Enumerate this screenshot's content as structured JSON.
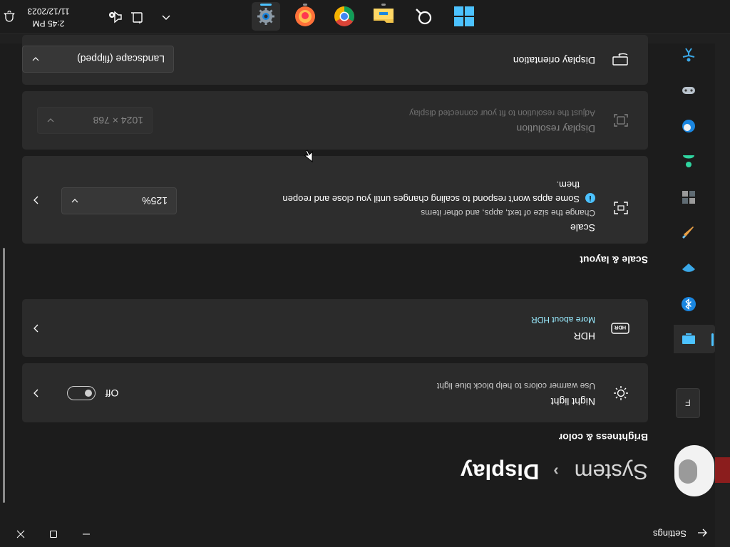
{
  "window": {
    "app_title": "Settings",
    "controls": {
      "minimize": "minimize-icon",
      "maximize": "maximize-icon",
      "close": "close-icon"
    }
  },
  "nav": {
    "search_label": "F",
    "items": [
      {
        "icon": "system-icon",
        "active": true
      },
      {
        "icon": "bluetooth-icon"
      },
      {
        "icon": "network-icon"
      },
      {
        "icon": "personalization-icon"
      },
      {
        "icon": "apps-icon"
      },
      {
        "icon": "accounts-icon"
      },
      {
        "icon": "time-language-icon"
      },
      {
        "icon": "gaming-icon"
      },
      {
        "icon": "accessibility-icon"
      }
    ]
  },
  "breadcrumb": {
    "parent": "System",
    "separator": "›",
    "current": "Display"
  },
  "brightness_section": {
    "title": "Brightness & color",
    "night_light": {
      "title": "Night light",
      "subtitle": "Use warmer colors to help block blue light",
      "toggle_state": "Off"
    },
    "hdr": {
      "title": "HDR",
      "link": "More about HDR"
    }
  },
  "scale_section": {
    "title": "Scale & layout",
    "scale": {
      "title": "Scale",
      "subtitle": "Change the size of text, apps, and other items",
      "warning_line1": "Some apps won't respond to scaling changes until you close and reopen",
      "warning_line2": "them.",
      "value": "125%"
    },
    "resolution": {
      "title": "Display resolution",
      "subtitle": "Adjust the resolution to fit your connected display",
      "value": "1024 × 768"
    },
    "orientation": {
      "title": "Display orientation",
      "value": "Landscape (flipped)"
    }
  },
  "taskbar": {
    "apps": [
      {
        "name": "windows-start-icon"
      },
      {
        "name": "search-icon"
      },
      {
        "name": "file-explorer-icon"
      },
      {
        "name": "chrome-icon"
      },
      {
        "name": "firefox-icon"
      },
      {
        "name": "settings-gear-icon",
        "active": true
      }
    ],
    "time": "2:45 PM",
    "date": "11/12/2023"
  },
  "colors": {
    "accent": "#4cc2ff",
    "link": "#99ebff",
    "card": "#2b2b2b",
    "background": "#1c1c1c"
  }
}
